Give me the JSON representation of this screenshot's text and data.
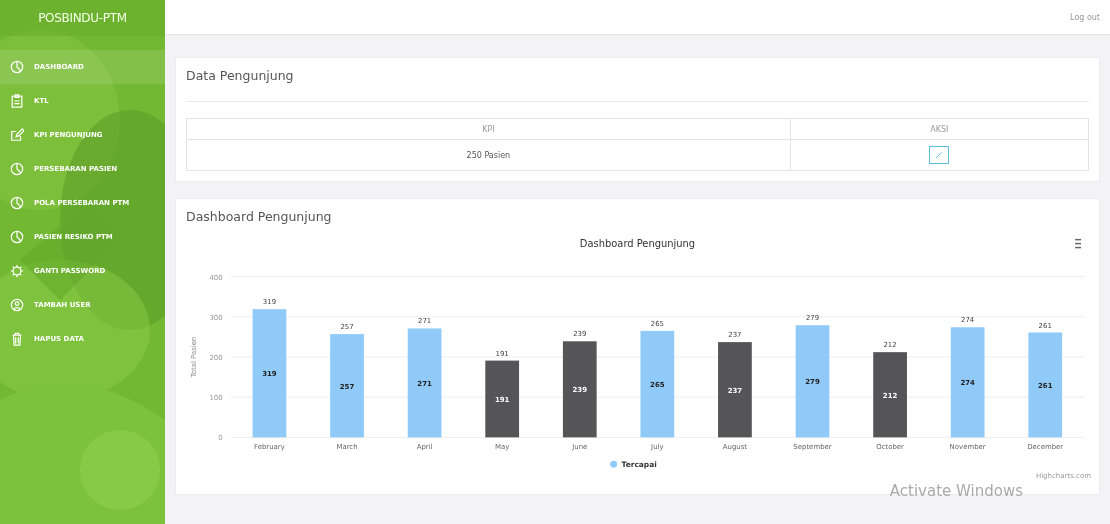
{
  "app": {
    "title": "POSBINDU-PTM"
  },
  "sidebar": {
    "items": [
      {
        "label": "DASHBOARD",
        "kind": "pie",
        "selected": true
      },
      {
        "label": "KTL",
        "kind": "clipboard",
        "selected": false
      },
      {
        "label": "KPI PENGUNJUNG",
        "kind": "edit",
        "selected": false
      },
      {
        "label": "PERSEBARAN PASIEN",
        "kind": "pie",
        "selected": false
      },
      {
        "label": "POLA PERSEBARAN PTM",
        "kind": "pie",
        "selected": false
      },
      {
        "label": "PASIEN RESIKO PTM",
        "kind": "pie",
        "selected": false
      },
      {
        "label": "GANTI PASSWORD",
        "kind": "gear",
        "selected": false
      },
      {
        "label": "TAMBAH USER",
        "kind": "user",
        "selected": false
      },
      {
        "label": "HAPUS DATA",
        "kind": "trash",
        "selected": false
      }
    ]
  },
  "topbar": {
    "logout": "Log out"
  },
  "data_card": {
    "title": "Data Pengunjung",
    "table": {
      "columns": [
        "KPI",
        "AKSI"
      ],
      "rows": [
        {
          "kpi": "250 Pasien"
        }
      ]
    }
  },
  "chart_card": {
    "title": "Dashboard Pengunjung",
    "chart_data": {
      "type": "bar",
      "title": "Dashboard Pengunjung",
      "ylabel": "Total Pasien",
      "categories": [
        "February",
        "March",
        "April",
        "May",
        "June",
        "July",
        "August",
        "September",
        "October",
        "November",
        "December"
      ],
      "series": [
        {
          "name": "Tercapai",
          "color": "#90caf9",
          "values": [
            319,
            257,
            271,
            null,
            null,
            265,
            null,
            279,
            null,
            274,
            261
          ]
        },
        {
          "color": "#555558",
          "values": [
            null,
            null,
            null,
            191,
            239,
            null,
            237,
            null,
            212,
            null,
            null
          ]
        }
      ],
      "ylim": [
        0,
        400
      ],
      "yticks": [
        0,
        100,
        200,
        300,
        400
      ],
      "grid": true,
      "data_labels": true,
      "annotations": [
        {
          "text": "319"
        },
        {
          "text": "257"
        },
        {
          "text": "271"
        },
        {
          "text": "191"
        },
        {
          "text": "239"
        },
        {
          "text": "265"
        },
        {
          "text": "237"
        },
        {
          "text": "279"
        },
        {
          "text": "212"
        },
        {
          "text": "274"
        },
        {
          "text": "261"
        }
      ]
    },
    "credit": "Highcharts.com"
  },
  "os_notice": "Activate Windows"
}
